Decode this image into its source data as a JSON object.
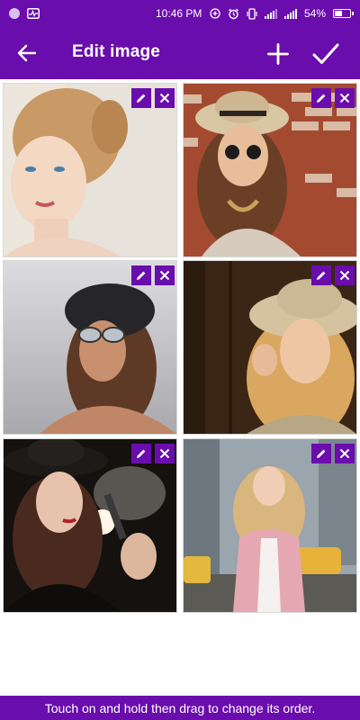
{
  "status_bar": {
    "time": "10:46 PM",
    "battery": "54%",
    "battery_level": 0.54,
    "icons": [
      "notification-dot-icon",
      "activity-icon",
      "data-saver-icon",
      "alarm-icon",
      "vibrate-icon",
      "signal-icon",
      "signal-icon",
      "battery-icon"
    ]
  },
  "app_bar": {
    "title": "Edit image",
    "back_icon": "arrow-left-icon",
    "add_icon": "plus-icon",
    "done_icon": "check-icon"
  },
  "images": [
    {
      "subject": "woman-curly-updo",
      "palette": [
        "#e9ddd2",
        "#c79a6c",
        "#f2d9c5"
      ]
    },
    {
      "subject": "woman-straw-hat-brick-wall",
      "palette": [
        "#a34a30",
        "#d8c1a4",
        "#6b3f28"
      ]
    },
    {
      "subject": "woman-beanie-sunglasses",
      "palette": [
        "#d7d6db",
        "#2a2a2e",
        "#b47a5c"
      ]
    },
    {
      "subject": "woman-hat-wooden-wall",
      "palette": [
        "#3a2414",
        "#d9c7a6",
        "#e2a870"
      ]
    },
    {
      "subject": "woman-black-hat-vaping",
      "palette": [
        "#1a1613",
        "#f0e6dc",
        "#8a4a3a"
      ]
    },
    {
      "subject": "woman-pink-coat-street",
      "palette": [
        "#8d9aa6",
        "#e1a9b1",
        "#d8b36a"
      ]
    }
  ],
  "tile_actions": {
    "edit_icon": "pencil-icon",
    "remove_icon": "close-icon"
  },
  "colors": {
    "accent": "#6a0dad",
    "on_accent": "#ffffff"
  },
  "hint": "Touch on and hold then drag to change its order."
}
